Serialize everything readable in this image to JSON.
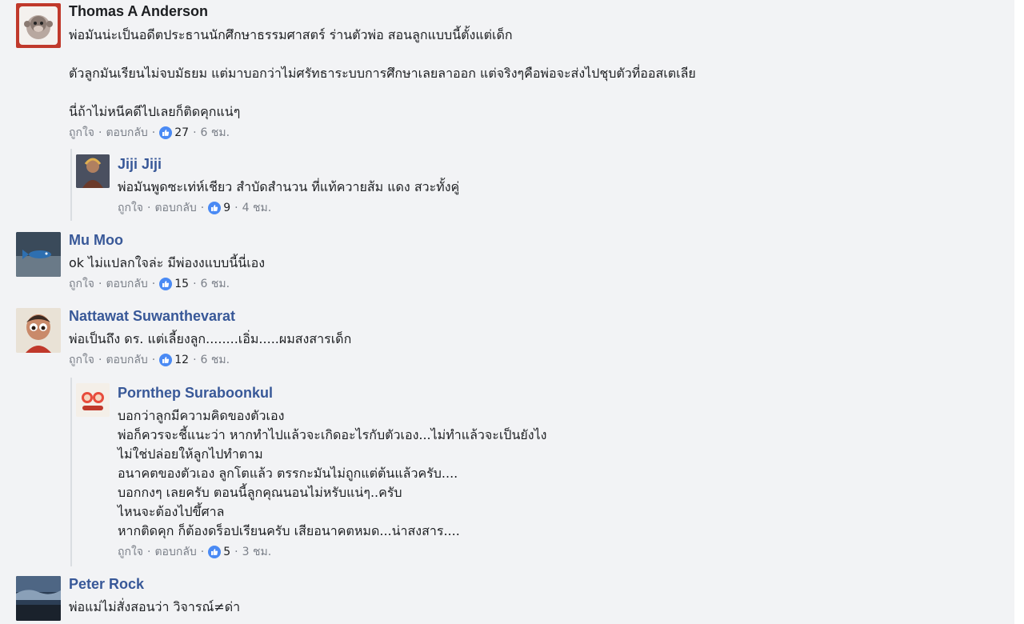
{
  "colors": {
    "name": "#385898",
    "text": "#1c1e21",
    "meta": "#7a7f88",
    "like_badge": "#4a8af4",
    "background": "#f2f3f5"
  },
  "actions": {
    "like": "ถูกใจ",
    "reply": "ตอบกลับ",
    "separator": "·"
  },
  "comments": [
    {
      "author": "Thomas A Anderson",
      "lines": [
        "พ่อมันน่ะเป็นอดีตประธานนักศึกษาธรรมศาสตร์ ร่านตัวพ่อ สอนลูกแบบนี้ตั้งแต่เด็ก",
        "",
        "ตัวลูกมันเรียนไม่จบมัธยม แต่มาบอกว่าไม่ศรัทธาระบบการศึกษาเลยลาออก แต่จริงๆคือพ่อจะส่งไปชุบตัวที่ออสเตเลีย",
        "",
        "นี่ถ้าไม่หนีคดีไปเลยก็ติดคุกแน่ๆ"
      ],
      "likes": "27",
      "time": "6 ชม.",
      "avatar_icon": "monkey-avatar"
    },
    {
      "author": "Jiji Jiji",
      "lines": [
        "พ่อมันพูดซะเท่ห์เชียว สำบัดสำนวน ที่แท้ควายส้ม แดง สวะทั้งคู่"
      ],
      "likes": "9",
      "time": "4 ชม.",
      "avatar_icon": "character-avatar"
    },
    {
      "author": "Mu Moo",
      "lines": [
        "ok ไม่แปลกใจล่ะ มีพ่องงแบบนี้นี่เอง"
      ],
      "likes": "15",
      "time": "6 ชม.",
      "avatar_icon": "fish-photo-avatar"
    },
    {
      "author": "Nattawat Suwanthevarat",
      "lines": [
        "พ่อเป็นถึง ดร. แต่เลี้ยงลูก........เอิ่ม.....ผมสงสารเด็ก"
      ],
      "likes": "12",
      "time": "6 ชม.",
      "avatar_icon": "cartoon-child-avatar"
    },
    {
      "author": "Pornthep Suraboonkul",
      "lines": [
        "บอกว่าลูกมีความคิดของตัวเอง",
        "พ่อก็ควรจะชี้แนะว่า หากทำไปแล้วจะเกิดอะไรกับตัวเอง...ไม่ทำแล้วจะเป็นยังไง",
        "ไม่ใช่ปล่อยให้ลูกไปทำตาม",
        "อนาคตของตัวเอง ลูกโตแล้ว ตรรกะมันไม่ถูกแต่ต้นแล้วครับ....",
        "บอกกงๆ เลยครับ ตอนนี้ลูกคุณนอนไม่หรับแน่ๆ..ครับ",
        "ไหนจะต้องไปขึ้ศาล",
        "หากติดคุก ก็ต้องดร็อปเรียนครับ เสียอนาคตหมด...น่าสงสาร...."
      ],
      "likes": "5",
      "time": "3 ชม.",
      "avatar_icon": "cartoon-pair-avatar"
    },
    {
      "author": "Peter Rock",
      "lines": [
        "พ่อแม่ไม่สั่งสอนว่า วิจารณ์≠ด่า"
      ],
      "avatar_icon": "sky-photo-avatar"
    }
  ]
}
